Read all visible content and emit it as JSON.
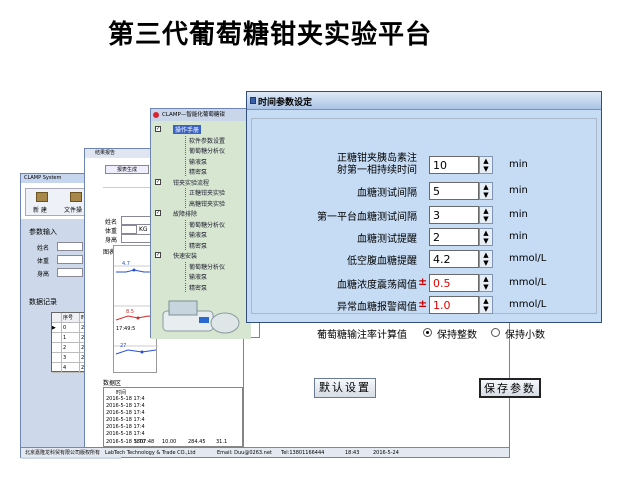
{
  "title": "第三代葡萄糖钳夹实验平台",
  "win1": {
    "title": "CLAMP System",
    "toolbar": {
      "new": "新 建",
      "open": "文件操"
    },
    "params_section": "参数输入",
    "params": [
      {
        "label": "姓名",
        "unit": ""
      },
      {
        "label": "体重",
        "unit": "Kg"
      },
      {
        "label": "身高",
        "unit": "cm"
      }
    ],
    "records_section": "数据记录",
    "grid_headers": [
      "序号",
      "时间"
    ],
    "grid_rows": [
      {
        "idx": "0",
        "time": "2016-05-1",
        "current": true
      },
      {
        "idx": "1",
        "time": "2016-05-1",
        "current": false
      },
      {
        "idx": "2",
        "time": "2016-05-1",
        "current": false
      },
      {
        "idx": "3",
        "time": "2016-05-1",
        "current": false
      },
      {
        "idx": "4",
        "time": "2016-05-1",
        "current": false
      }
    ],
    "status": {
      "company": "北京嘉隆龙科贸有限公司版权所有",
      "en": "LabTech Technology & Trade CO.,Ltd",
      "mail": "Email: Duu@0263.net",
      "tel": "Tel:13801166444",
      "time": "18:43",
      "date": "2016-5-24"
    }
  },
  "win2": {
    "title": "结果报告",
    "buttons": [
      "报表生成",
      "实验"
    ],
    "labels": [
      "姓名",
      "体重",
      "身高"
    ],
    "weight_unit": "KG",
    "chart_label": "图表区",
    "chart_values": [
      "4.7",
      "8.5",
      "27"
    ],
    "chart_time": "17:49:5",
    "data_label": "数据区",
    "data_header": "时间",
    "data_rows": [
      "2016-5-18 17:4",
      "2016-5-18 17:4",
      "2016-5-18 17:4",
      "2016-5-18 17:4",
      "2016-5-18 17:4",
      "2016-5-18 17:4"
    ],
    "last_row": [
      "2016-5-18 1807:48",
      "5.70",
      "10.00",
      "284.45",
      "31.1"
    ]
  },
  "win3": {
    "title": "CLAMP—智能化葡萄糖钳",
    "tree": [
      {
        "text": "操作手册",
        "level": 0,
        "checkbox": true,
        "selected": true
      },
      {
        "text": "软件参数设置",
        "level": 1
      },
      {
        "text": "葡萄糖分析仪",
        "level": 1
      },
      {
        "text": "输液泵",
        "level": 1
      },
      {
        "text": "精密泵",
        "level": 1
      },
      {
        "text": "钳夹实验流程",
        "level": 0,
        "checkbox": true
      },
      {
        "text": "正糖钳夹实验",
        "level": 1
      },
      {
        "text": "高糖钳夹实验",
        "level": 1
      },
      {
        "text": "故障排除",
        "level": 0,
        "checkbox": true
      },
      {
        "text": "葡萄糖分析仪",
        "level": 1
      },
      {
        "text": "输液泵",
        "level": 1
      },
      {
        "text": "精密泵",
        "level": 1
      },
      {
        "text": "快速安装",
        "level": 0,
        "checkbox": true
      },
      {
        "text": "葡萄糖分析仪",
        "level": 1
      },
      {
        "text": "输液泵",
        "level": 1
      },
      {
        "text": "精密泵",
        "level": 1
      }
    ]
  },
  "dialog": {
    "title": "时间参数设定",
    "fields": [
      {
        "label_lines": [
          "正糖钳夹胰岛素注",
          "射第一相持续时间"
        ],
        "value": "10",
        "unit": "min",
        "pm": false
      },
      {
        "label_lines": [
          "血糖测试间隔"
        ],
        "value": "5",
        "unit": "min",
        "pm": false
      },
      {
        "label_lines": [
          "第一平台血糖测试间隔"
        ],
        "value": "3",
        "unit": "min",
        "pm": false
      },
      {
        "label_lines": [
          "血糖测试提醒"
        ],
        "value": "2",
        "unit": "min",
        "pm": false
      },
      {
        "label_lines": [
          "低空腹血糖提醒"
        ],
        "value": "4.2",
        "unit": "mmol/L",
        "pm": false
      },
      {
        "label_lines": [
          "血糖浓度震荡阈值"
        ],
        "value": "0.5",
        "unit": "mmol/L",
        "pm": true
      },
      {
        "label_lines": [
          "异常血糖报警阈值"
        ],
        "value": "1.0",
        "unit": "mmol/L",
        "pm": true
      }
    ],
    "plusminus": "±",
    "rate_label": "葡萄糖输注率计算值",
    "rate_options": [
      {
        "label": "保持整数",
        "selected": true
      },
      {
        "label": "保持小数",
        "selected": false
      }
    ],
    "default_button": "默认设置",
    "save_button": "保存参数"
  }
}
